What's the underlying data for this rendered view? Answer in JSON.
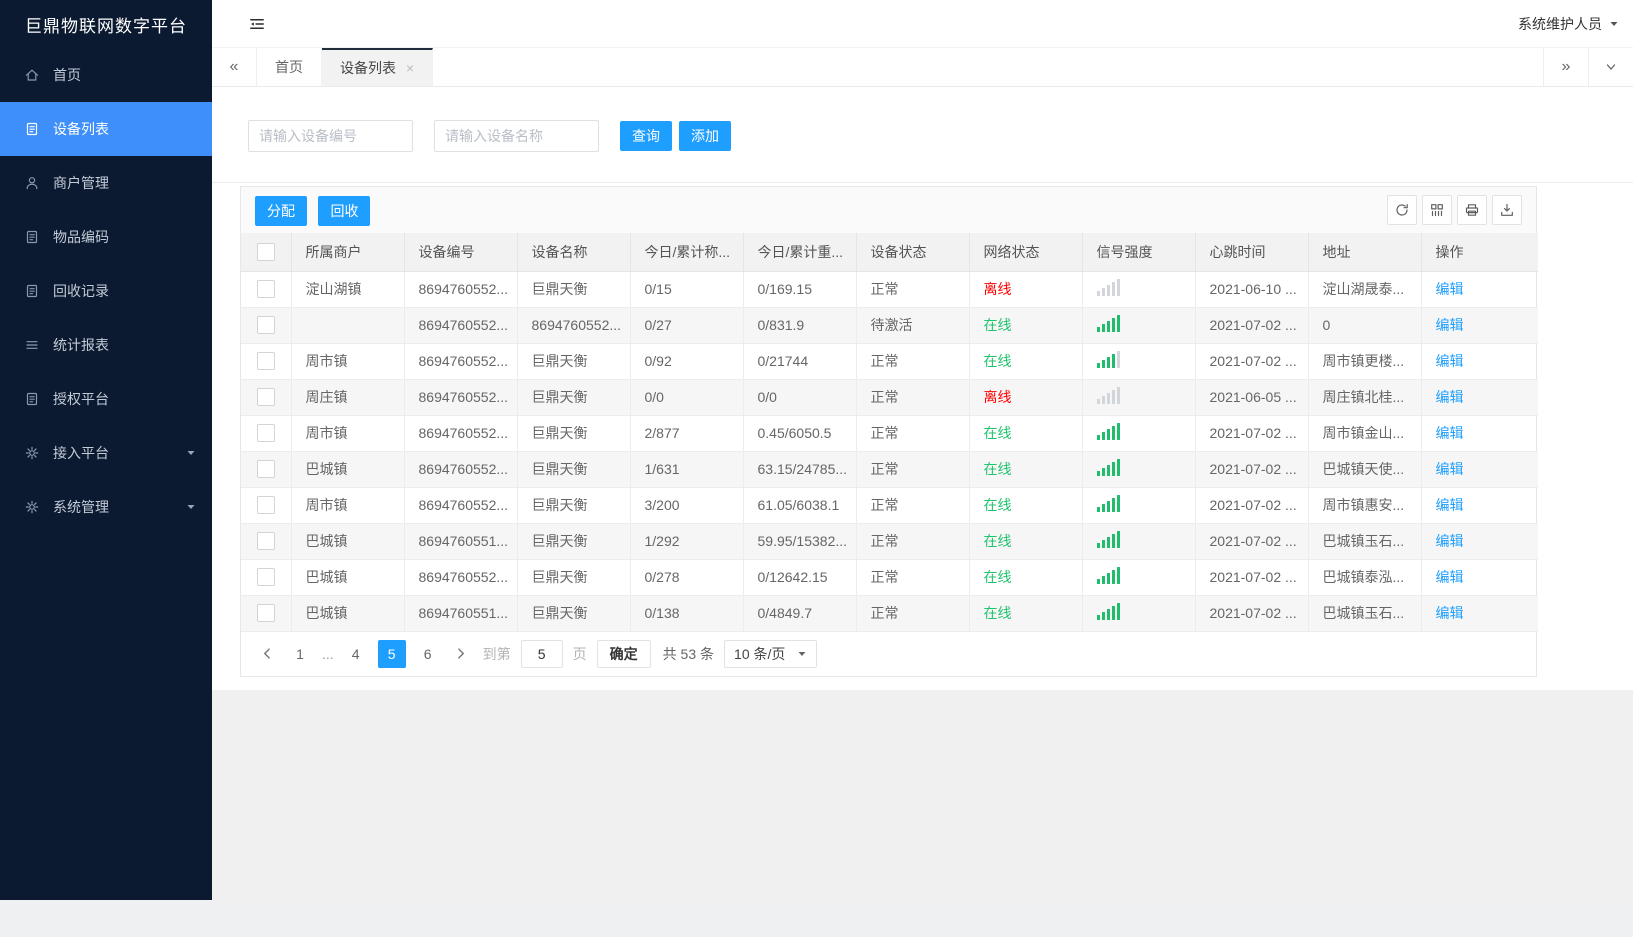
{
  "sidebar": {
    "title": "巨鼎物联网数字平台",
    "items": [
      {
        "id": "home",
        "label": "首页",
        "icon": "home",
        "active": false,
        "expandable": false
      },
      {
        "id": "device-list",
        "label": "设备列表",
        "icon": "doc",
        "active": true,
        "expandable": false
      },
      {
        "id": "merchant-mgmt",
        "label": "商户管理",
        "icon": "user",
        "active": false,
        "expandable": false
      },
      {
        "id": "item-code",
        "label": "物品编码",
        "icon": "doc",
        "active": false,
        "expandable": false
      },
      {
        "id": "recycle-record",
        "label": "回收记录",
        "icon": "doc",
        "active": false,
        "expandable": false
      },
      {
        "id": "stats-report",
        "label": "统计报表",
        "icon": "lines",
        "active": false,
        "expandable": false
      },
      {
        "id": "auth-platform",
        "label": "授权平台",
        "icon": "doc",
        "active": false,
        "expandable": false
      },
      {
        "id": "access-platform",
        "label": "接入平台",
        "icon": "gear",
        "active": false,
        "expandable": true
      },
      {
        "id": "system-mgmt",
        "label": "系统管理",
        "icon": "gear",
        "active": false,
        "expandable": true
      }
    ]
  },
  "header": {
    "user": "系统维护人员"
  },
  "tabs": [
    {
      "label": "首页",
      "active": false,
      "closable": false
    },
    {
      "label": "设备列表",
      "active": true,
      "closable": true
    }
  ],
  "search": {
    "device_no_placeholder": "请输入设备编号",
    "device_name_placeholder": "请输入设备名称",
    "query_label": "查询",
    "add_label": "添加"
  },
  "toolbar": {
    "assign_label": "分配",
    "recycle_label": "回收"
  },
  "table": {
    "columns": [
      "所属商户",
      "设备编号",
      "设备名称",
      "今日/累计称...",
      "今日/累计重...",
      "设备状态",
      "网络状态",
      "信号强度",
      "心跳时间",
      "地址",
      "操作"
    ],
    "edit_label": "编辑",
    "rows": [
      {
        "merchant": "淀山湖镇",
        "device_no": "8694760552...",
        "device_name": "巨鼎天衡",
        "today_count": "0/15",
        "today_weight": "0/169.15",
        "device_status": "正常",
        "network_status": "离线",
        "online": false,
        "signal": 0,
        "heartbeat": "2021-06-10 ...",
        "address": "淀山湖晟泰..."
      },
      {
        "merchant": "",
        "device_no": "8694760552...",
        "device_name": "8694760552...",
        "today_count": "0/27",
        "today_weight": "0/831.9",
        "device_status": "待激活",
        "network_status": "在线",
        "online": true,
        "signal": 5,
        "heartbeat": "2021-07-02 ...",
        "address": "0"
      },
      {
        "merchant": "周市镇",
        "device_no": "8694760552...",
        "device_name": "巨鼎天衡",
        "today_count": "0/92",
        "today_weight": "0/21744",
        "device_status": "正常",
        "network_status": "在线",
        "online": true,
        "signal": 4,
        "heartbeat": "2021-07-02 ...",
        "address": "周市镇更楼..."
      },
      {
        "merchant": "周庄镇",
        "device_no": "8694760552...",
        "device_name": "巨鼎天衡",
        "today_count": "0/0",
        "today_weight": "0/0",
        "device_status": "正常",
        "network_status": "离线",
        "online": false,
        "signal": 0,
        "heartbeat": "2021-06-05 ...",
        "address": "周庄镇北桂..."
      },
      {
        "merchant": "周市镇",
        "device_no": "8694760552...",
        "device_name": "巨鼎天衡",
        "today_count": "2/877",
        "today_weight": "0.45/6050.5",
        "device_status": "正常",
        "network_status": "在线",
        "online": true,
        "signal": 5,
        "heartbeat": "2021-07-02 ...",
        "address": "周市镇金山..."
      },
      {
        "merchant": "巴城镇",
        "device_no": "8694760552...",
        "device_name": "巨鼎天衡",
        "today_count": "1/631",
        "today_weight": "63.15/24785...",
        "device_status": "正常",
        "network_status": "在线",
        "online": true,
        "signal": 5,
        "heartbeat": "2021-07-02 ...",
        "address": "巴城镇天使..."
      },
      {
        "merchant": "周市镇",
        "device_no": "8694760552...",
        "device_name": "巨鼎天衡",
        "today_count": "3/200",
        "today_weight": "61.05/6038.1",
        "device_status": "正常",
        "network_status": "在线",
        "online": true,
        "signal": 5,
        "heartbeat": "2021-07-02 ...",
        "address": "周市镇惠安..."
      },
      {
        "merchant": "巴城镇",
        "device_no": "8694760551...",
        "device_name": "巨鼎天衡",
        "today_count": "1/292",
        "today_weight": "59.95/15382...",
        "device_status": "正常",
        "network_status": "在线",
        "online": true,
        "signal": 5,
        "heartbeat": "2021-07-02 ...",
        "address": "巴城镇玉石..."
      },
      {
        "merchant": "巴城镇",
        "device_no": "8694760552...",
        "device_name": "巨鼎天衡",
        "today_count": "0/278",
        "today_weight": "0/12642.15",
        "device_status": "正常",
        "network_status": "在线",
        "online": true,
        "signal": 5,
        "heartbeat": "2021-07-02 ...",
        "address": "巴城镇泰泓..."
      },
      {
        "merchant": "巴城镇",
        "device_no": "8694760551...",
        "device_name": "巨鼎天衡",
        "today_count": "0/138",
        "today_weight": "0/4849.7",
        "device_status": "正常",
        "network_status": "在线",
        "online": true,
        "signal": 5,
        "heartbeat": "2021-07-02 ...",
        "address": "巴城镇玉石..."
      }
    ]
  },
  "pagination": {
    "pages": [
      "1",
      "...",
      "4",
      "5",
      "6"
    ],
    "active_page": "5",
    "goto_label": "到第",
    "goto_value": "5",
    "page_unit": "页",
    "confirm_label": "确定",
    "total_label": "共 53 条",
    "page_size": "10 条/页"
  },
  "colors": {
    "primary": "#1e9fff",
    "sidebar_bg": "#0b1a31",
    "sidebar_active": "#3e8ff9",
    "online_green": "#22c26e",
    "offline_red": "#ff0000",
    "signal_green": "#1fbc6c",
    "signal_gray": "#d2d5da"
  }
}
